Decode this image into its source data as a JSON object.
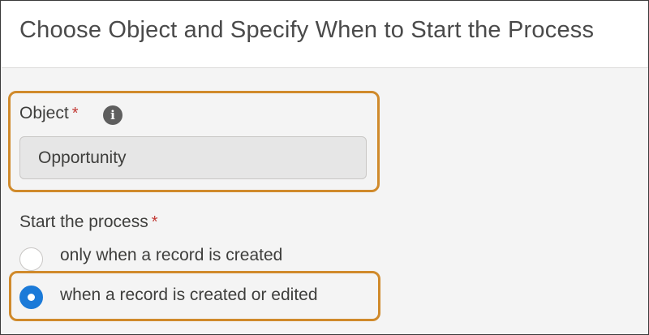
{
  "header": {
    "title": "Choose Object and Specify When to Start the Process"
  },
  "object": {
    "label": "Object",
    "required_marker": "*",
    "info_icon": "info-icon",
    "value": "Opportunity"
  },
  "start": {
    "label": "Start the process",
    "required_marker": "*",
    "options": [
      {
        "label": "only when a record is created",
        "selected": false
      },
      {
        "label": "when a record is created or edited",
        "selected": true
      }
    ]
  },
  "colors": {
    "highlight": "#d08a2b",
    "required": "#c23934",
    "radio_selected": "#1b7ad8"
  }
}
